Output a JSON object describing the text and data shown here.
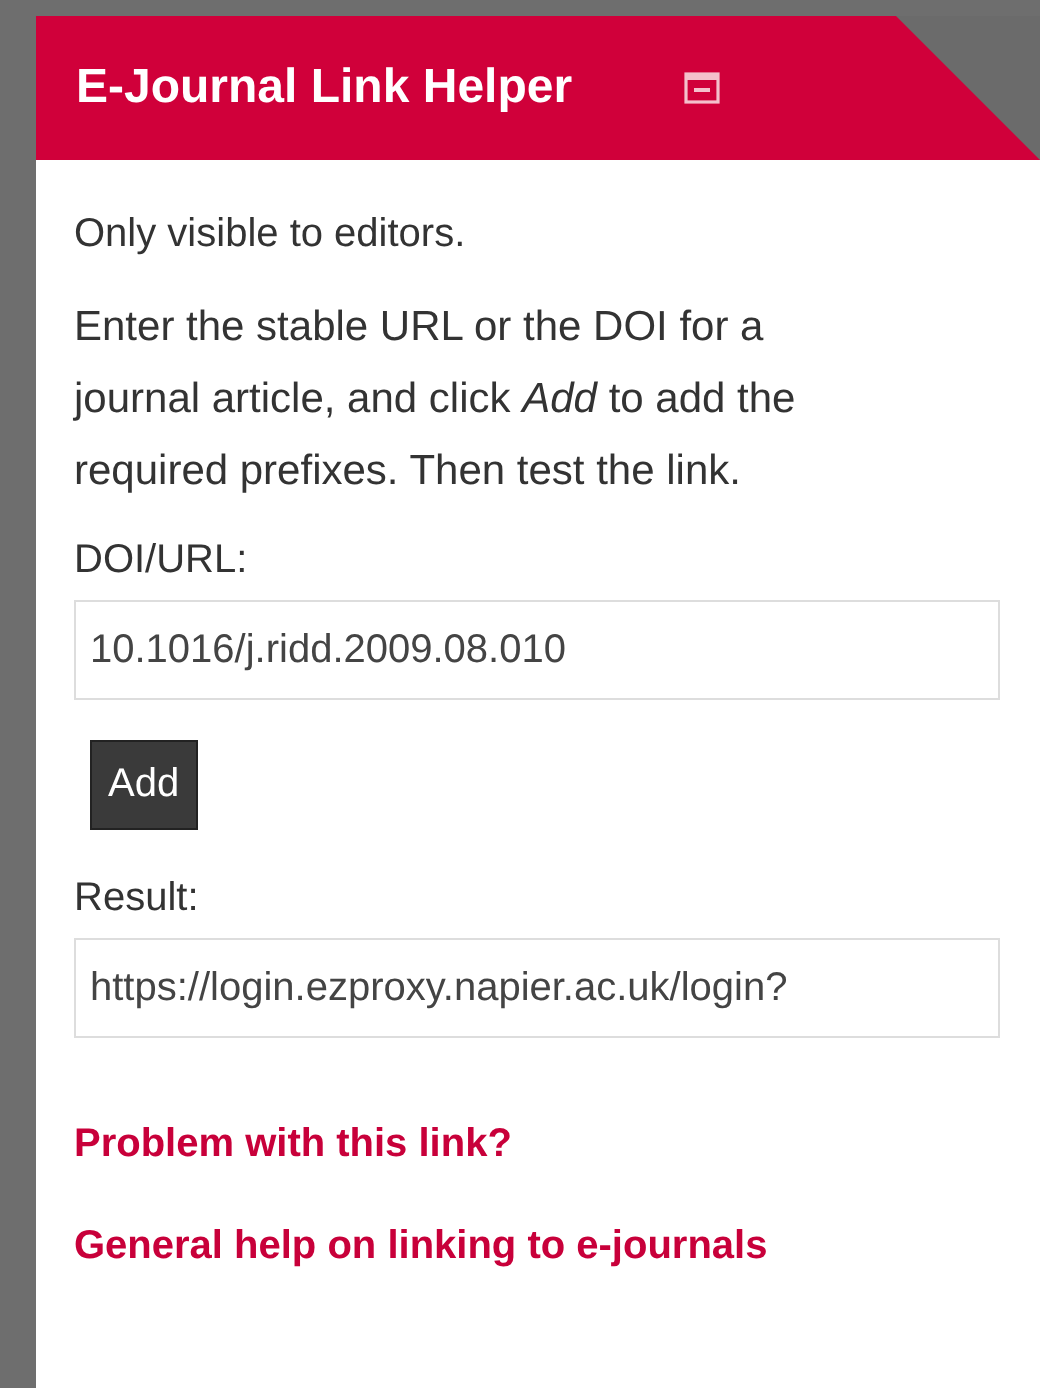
{
  "panel": {
    "title": "E-Journal Link Helper",
    "collapsed": false
  },
  "notice": "Only visible to editors.",
  "instructions": "Enter the stable URL or the DOI for a journal article, and click *Add* to add the required prefixes. Then test the link.",
  "doi_field": {
    "label": "DOI/URL:",
    "value": "10.1016/j.ridd.2009.08.010"
  },
  "add_button": "Add",
  "result_field": {
    "label": "Result:",
    "value": "https://login.ezproxy.napier.ac.uk/login?"
  },
  "links": [
    "Problem with this link?",
    "General help on linking to e-journals"
  ]
}
